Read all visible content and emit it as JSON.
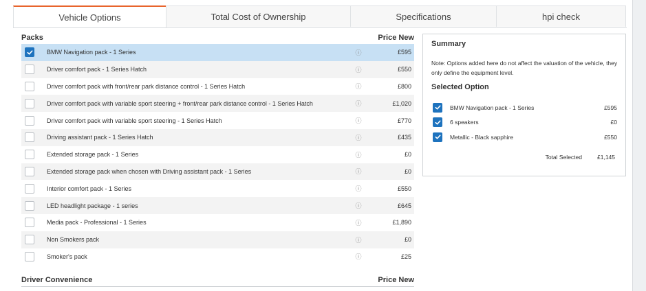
{
  "tabs": [
    {
      "label": "Vehicle Options"
    },
    {
      "label": "Total Cost of Ownership"
    },
    {
      "label": "Specifications"
    },
    {
      "label": "hpi check"
    }
  ],
  "packs": {
    "title": "Packs",
    "price_header": "Price New",
    "rows": [
      {
        "name": "BMW Navigation pack - 1 Series",
        "price": "£595",
        "checked": true
      },
      {
        "name": "Driver comfort pack - 1 Series Hatch",
        "price": "£550",
        "checked": false
      },
      {
        "name": "Driver comfort pack with front/rear park distance control - 1 Series Hatch",
        "price": "£800",
        "checked": false
      },
      {
        "name": "Driver comfort pack with variable sport steering + front/rear park distance control - 1 Series Hatch",
        "price": "£1,020",
        "checked": false
      },
      {
        "name": "Driver comfort pack with variable sport steering - 1 Series Hatch",
        "price": "£770",
        "checked": false
      },
      {
        "name": "Driving assistant pack - 1 Series Hatch",
        "price": "£435",
        "checked": false
      },
      {
        "name": "Extended storage pack - 1 Series",
        "price": "£0",
        "checked": false
      },
      {
        "name": "Extended storage pack when chosen with Driving assistant pack - 1 Series",
        "price": "£0",
        "checked": false
      },
      {
        "name": "Interior comfort pack - 1 Series",
        "price": "£550",
        "checked": false
      },
      {
        "name": "LED headlight package - 1 series",
        "price": "£645",
        "checked": false
      },
      {
        "name": "Media pack - Professional - 1 Series",
        "price": "£1,890",
        "checked": false
      },
      {
        "name": "Non Smokers pack",
        "price": "£0",
        "checked": false
      },
      {
        "name": "Smoker's pack",
        "price": "£25",
        "checked": false
      }
    ]
  },
  "driver_convenience": {
    "title": "Driver Convenience",
    "price_header": "Price New"
  },
  "summary": {
    "title": "Summary",
    "note": "Note: Options added here do not affect the valuation of the vehicle, they only define the equipment level.",
    "selected_title": "Selected Option",
    "selected": [
      {
        "name": "BMW Navigation pack - 1 Series",
        "price": "£595"
      },
      {
        "name": "6 speakers",
        "price": "£0"
      },
      {
        "name": "Metallic - Black sapphire",
        "price": "£550"
      }
    ],
    "total_label": "Total Selected",
    "total_value": "£1,145"
  },
  "colors": {
    "accent": "#e8642c",
    "check": "#1e73be",
    "selected_row": "#c7e0f4"
  }
}
